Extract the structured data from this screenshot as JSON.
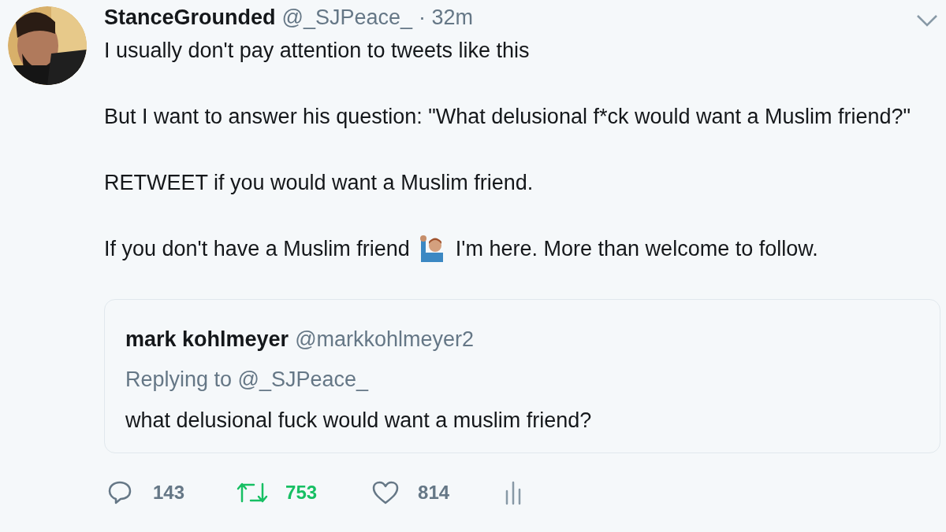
{
  "tweet": {
    "name": "StanceGrounded",
    "handle": "@_SJPeace_",
    "time": "· 32m",
    "paragraphs": [
      "I usually don't pay attention to tweets like this",
      "But I want to answer his question: \"What delusional f*ck would want a Muslim friend?\"",
      "RETWEET if you would want a Muslim friend."
    ],
    "last_paragraph": {
      "before": "If you don't have a Muslim friend",
      "after": "I'm here. More than welcome to follow."
    },
    "quoted": {
      "name": "mark kohlmeyer",
      "handle": "@markkohlmeyer2",
      "replying_to": "Replying to @_SJPeace_",
      "text": "what delusional fuck would want a muslim friend?"
    },
    "actions": {
      "replies": "143",
      "retweets": "753",
      "retweeted": true,
      "likes": "814",
      "liked": false
    }
  }
}
